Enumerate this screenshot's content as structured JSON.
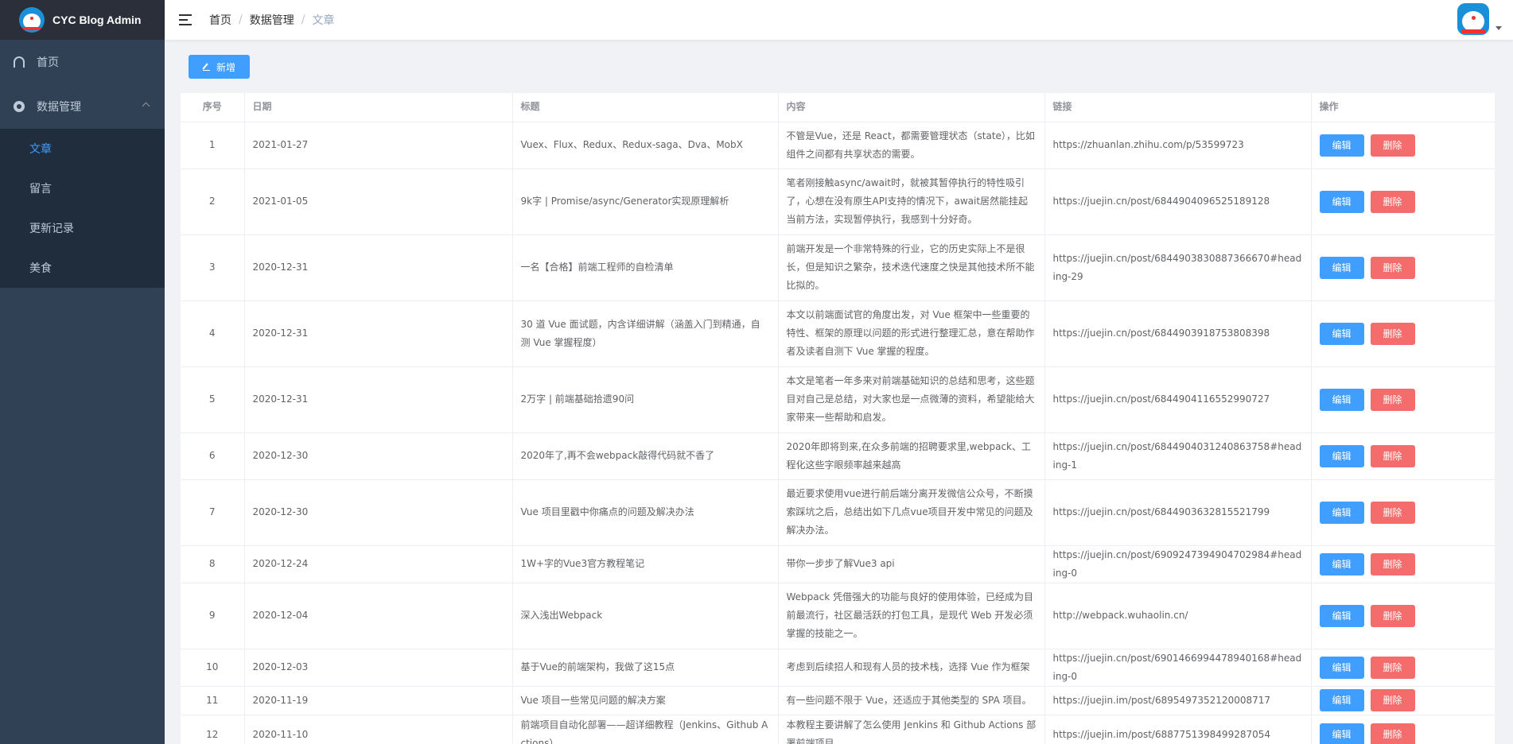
{
  "app": {
    "title": "CYC Blog Admin"
  },
  "sidebar": {
    "items": [
      {
        "label": "首页",
        "icon": "dashboard-icon"
      },
      {
        "label": "数据管理",
        "icon": "circle-icon",
        "expanded": true,
        "children": [
          {
            "label": "文章",
            "active": true
          },
          {
            "label": "留言"
          },
          {
            "label": "更新记录"
          },
          {
            "label": "美食"
          }
        ]
      }
    ]
  },
  "breadcrumb": [
    "首页",
    "数据管理",
    "文章"
  ],
  "toolbar": {
    "add_label": "新增"
  },
  "table": {
    "headers": [
      "序号",
      "日期",
      "标题",
      "内容",
      "链接",
      "操作"
    ],
    "edit_label": "编辑",
    "delete_label": "删除",
    "rows": [
      {
        "idx": "1",
        "date": "2021-01-27",
        "title": "Vuex、Flux、Redux、Redux-saga、Dva、MobX",
        "content": "不管是Vue，还是 React，都需要管理状态（state），比如组件之间都有共享状态的需要。",
        "link": "https://zhuanlan.zhihu.com/p/53599723"
      },
      {
        "idx": "2",
        "date": "2021-01-05",
        "title": "9k字 | Promise/async/Generator实现原理解析",
        "content": "笔者刚接触async/await时，就被其暂停执行的特性吸引了，心想在没有原生API支持的情况下，await居然能挂起当前方法，实现暂停执行，我感到十分好奇。",
        "link": "https://juejin.cn/post/6844904096525189128"
      },
      {
        "idx": "3",
        "date": "2020-12-31",
        "title": "一名【合格】前端工程师的自检清单",
        "content": "前端开发是一个非常特殊的行业，它的历史实际上不是很长，但是知识之繁杂，技术迭代速度之快是其他技术所不能比拟的。",
        "link": "https://juejin.cn/post/6844903830887366670#heading-29"
      },
      {
        "idx": "4",
        "date": "2020-12-31",
        "title": "30 道 Vue 面试题，内含详细讲解（涵盖入门到精通，自测 Vue 掌握程度）",
        "content": "本文以前端面试官的角度出发，对 Vue 框架中一些重要的特性、框架的原理以问题的形式进行整理汇总，意在帮助作者及读者自测下 Vue 掌握的程度。",
        "link": "https://juejin.cn/post/6844903918753808398"
      },
      {
        "idx": "5",
        "date": "2020-12-31",
        "title": "2万字 | 前端基础拾遗90问",
        "content": "本文是笔者一年多来对前端基础知识的总结和思考，这些题目对自己是总结，对大家也是一点微薄的资料，希望能给大家带来一些帮助和启发。",
        "link": "https://juejin.cn/post/6844904116552990727"
      },
      {
        "idx": "6",
        "date": "2020-12-30",
        "title": "2020年了,再不会webpack敲得代码就不香了",
        "content": "2020年即将到来,在众多前端的招聘要求里,webpack、工程化这些字眼频率越来越高",
        "link": "https://juejin.cn/post/6844904031240863758#heading-1"
      },
      {
        "idx": "7",
        "date": "2020-12-30",
        "title": "Vue 项目里戳中你痛点的问题及解决办法",
        "content": "最近要求使用vue进行前后端分离开发微信公众号，不断摸索踩坑之后，总结出如下几点vue项目开发中常见的问题及解决办法。",
        "link": "https://juejin.cn/post/6844903632815521799"
      },
      {
        "idx": "8",
        "date": "2020-12-24",
        "title": "1W+字的Vue3官方教程笔记",
        "content": "带你一步步了解Vue3 api",
        "link": "https://juejin.cn/post/6909247394904702984#heading-0"
      },
      {
        "idx": "9",
        "date": "2020-12-04",
        "title": "深入浅出Webpack",
        "content": "Webpack 凭借强大的功能与良好的使用体验，已经成为目前最流行，社区最活跃的打包工具，是现代 Web 开发必须掌握的技能之一。",
        "link": "http://webpack.wuhaolin.cn/"
      },
      {
        "idx": "10",
        "date": "2020-12-03",
        "title": "基于Vue的前端架构，我做了这15点",
        "content": "考虑到后续招人和现有人员的技术栈，选择 Vue 作为框架",
        "link": "https://juejin.cn/post/6901466994478940168#heading-0"
      },
      {
        "idx": "11",
        "date": "2020-11-19",
        "title": "Vue 项目一些常见问题的解决方案",
        "content": "有一些问题不限于 Vue，还适应于其他类型的 SPA 项目。",
        "link": "https://juejin.im/post/6895497352120008717"
      },
      {
        "idx": "12",
        "date": "2020-11-10",
        "title": "前端项目自动化部署——超详细教程（Jenkins、Github Actions）",
        "content": "本教程主要讲解了怎么使用 Jenkins 和 Github Actions 部署前端项目。",
        "link": "https://juejin.im/post/6887751398499287054"
      }
    ]
  }
}
